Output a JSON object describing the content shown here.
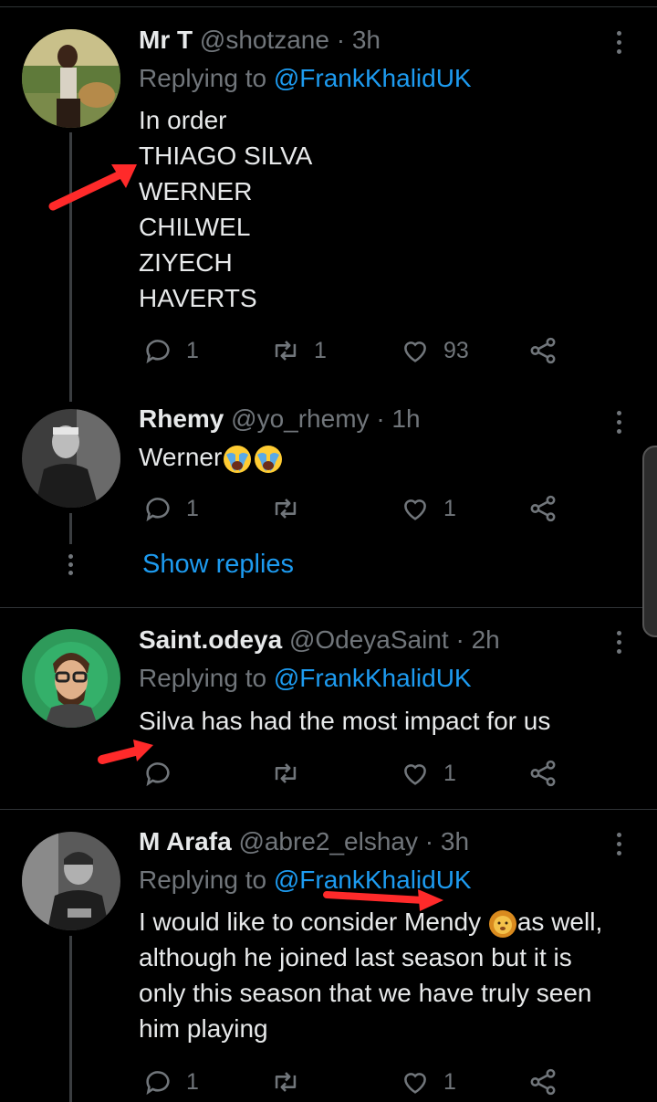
{
  "tweets": [
    {
      "name": "Mr T",
      "handle": "@shotzane",
      "time": "· 3h",
      "replying_prefix": "Replying to ",
      "replying_to": "@FrankKhalidUK",
      "lines": [
        "In order",
        "THIAGO SILVA",
        "WERNER",
        "CHILWEL",
        "ZIYECH",
        "HAVERTS"
      ],
      "replies": "1",
      "retweets": "1",
      "likes": "93"
    },
    {
      "name": "Rhemy",
      "handle": "@yo_rhemy",
      "time": "· 1h",
      "text": "Werner",
      "replies": "1",
      "retweets": "",
      "likes": "1",
      "show_replies": "Show replies"
    },
    {
      "name": "Saint.odeya",
      "handle": "@OdeyaSaint",
      "time": "· 2h",
      "replying_prefix": "Replying to ",
      "replying_to": "@FrankKhalidUK",
      "text": "Silva has had the most impact for us",
      "replies": "",
      "retweets": "",
      "likes": "1"
    },
    {
      "name": "M Arafa",
      "handle": "@abre2_elshay",
      "time": "· 3h",
      "replying_prefix": "Replying to ",
      "replying_to": "@FrankKhalidUK",
      "line1_a": "I would like to consider Mendy ",
      "line1_b": "as well,",
      "lines": [
        "although he joined last season but it is",
        "only this season that we have truly seen",
        "him playing"
      ],
      "replies": "1",
      "retweets": "",
      "likes": "1"
    }
  ],
  "icons": {
    "reply": "reply-icon",
    "retweet": "retweet-icon",
    "like": "heart-icon",
    "share": "share-icon",
    "more": "more-vertical-icon"
  },
  "colors": {
    "background": "#000000",
    "link": "#1d9bf0",
    "muted": "#71767b",
    "annotation": "#ff2a2a"
  }
}
